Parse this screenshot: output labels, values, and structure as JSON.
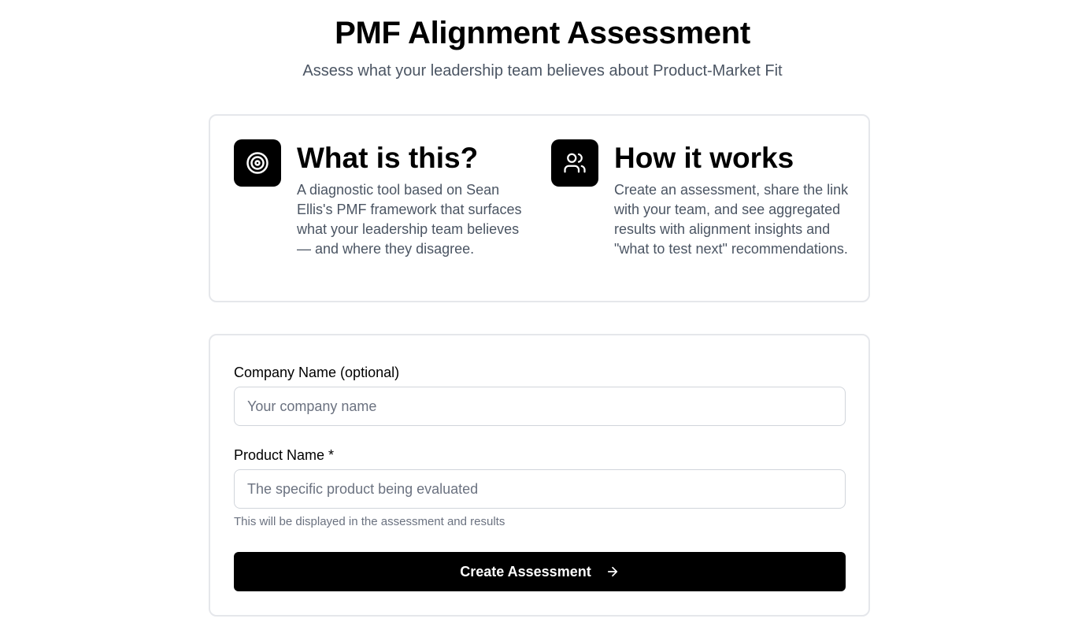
{
  "header": {
    "title": "PMF Alignment Assessment",
    "subtitle": "Assess what your leadership team believes about Product-Market Fit"
  },
  "info": {
    "features": [
      {
        "icon": "target-icon",
        "title": "What is this?",
        "text": "A diagnostic tool based on Sean Ellis's PMF framework that surfaces what your leadership team believes — and where they disagree."
      },
      {
        "icon": "users-icon",
        "title": "How it works",
        "text": "Create an assessment, share the link with your team, and see aggregated results with alignment insights and \"what to test next\" recommendations."
      }
    ]
  },
  "form": {
    "company_label": "Company Name (optional)",
    "company_placeholder": "Your company name",
    "company_value": "",
    "product_label": "Product Name *",
    "product_placeholder": "The specific product being evaluated",
    "product_value": "",
    "product_helper": "This will be displayed in the assessment and results",
    "submit_label": "Create Assessment",
    "submit_icon": "arrow-right-icon"
  },
  "colors": {
    "accent": "#000000",
    "muted_text": "#4b5563",
    "border": "#e5e7eb"
  }
}
